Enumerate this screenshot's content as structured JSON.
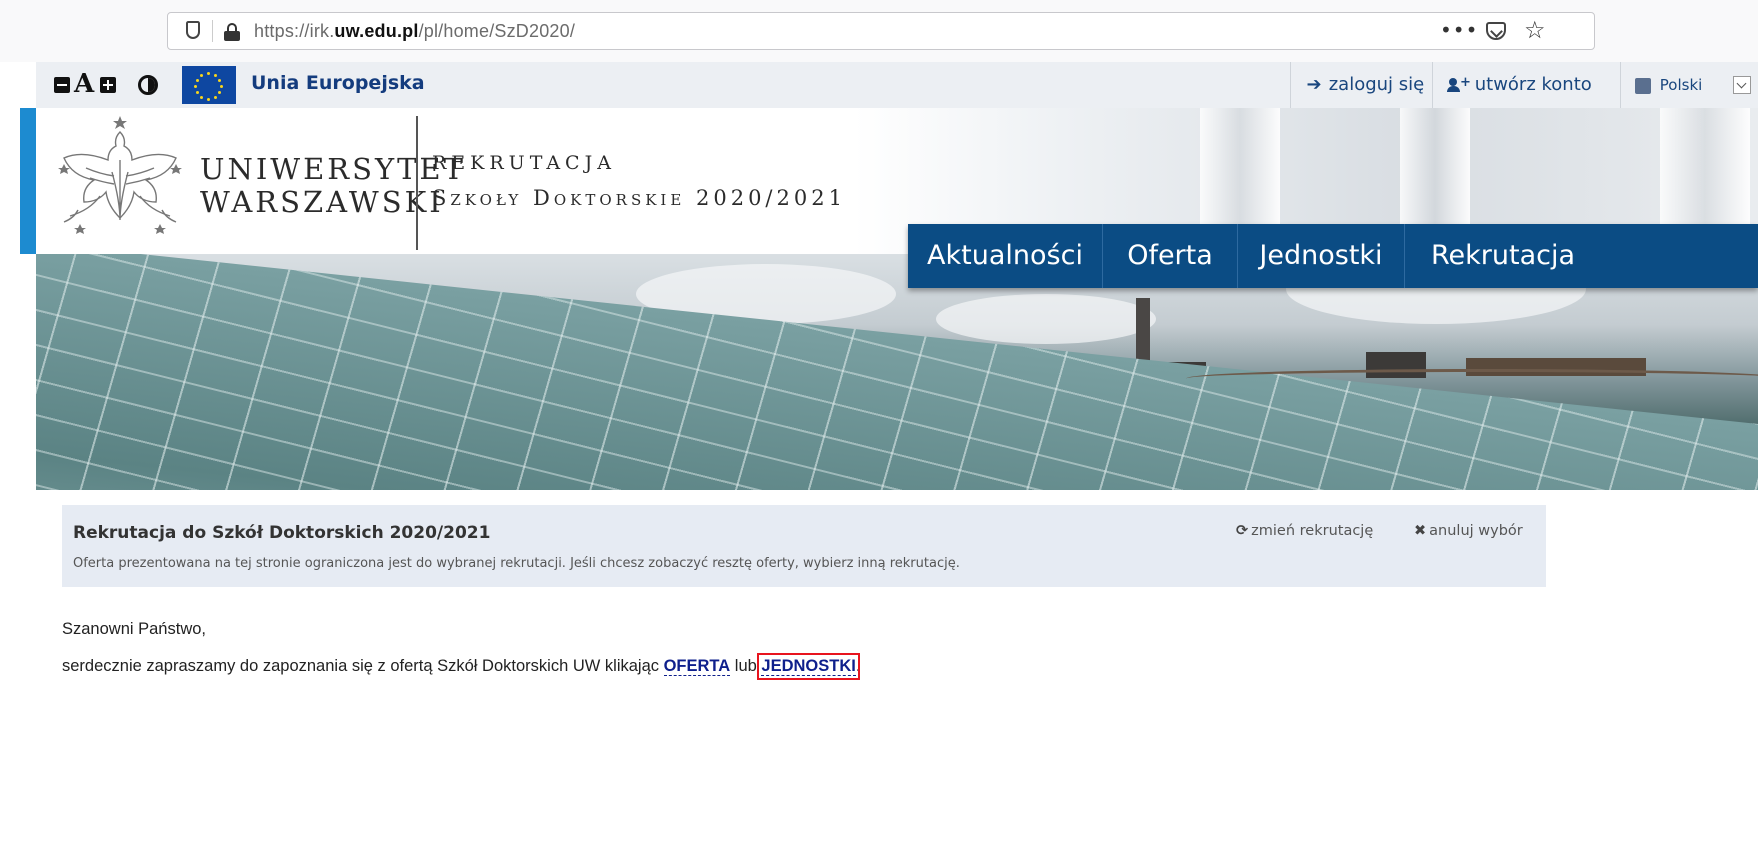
{
  "browser": {
    "url_prefix": "https://irk.",
    "url_domain": "uw.edu.pl",
    "url_path": "/pl/home/SzD2020/",
    "more_label": "•••"
  },
  "topbar": {
    "font_decrease_label": "A",
    "eu_label": "Unia Europejska",
    "login_label": "zaloguj się",
    "signup_label": "utwórz konto",
    "language_label": "Polski"
  },
  "header": {
    "university_line1": "UNIWERSYTET",
    "university_line2": "WARSZAWSKI",
    "recruitment_line1": "REKRUTACJA",
    "recruitment_line2": "Szkoły Doktorskie 2020/2021"
  },
  "nav": {
    "items": [
      {
        "label": "Aktualności"
      },
      {
        "label": "Oferta"
      },
      {
        "label": "Jednostki"
      },
      {
        "label": "Rekrutacja"
      }
    ]
  },
  "info": {
    "title": "Rekrutacja do Szkół Doktorskich 2020/2021",
    "subtitle": "Oferta prezentowana na tej stronie ograniczona jest do wybranej rekrutacji. Jeśli chcesz zobaczyć resztę oferty, wybierz inną rekrutację.",
    "change_label": "zmień rekrutację",
    "cancel_label": "anuluj wybór"
  },
  "content": {
    "greeting": "Szanowni Państwo,",
    "para_before": "serdecznie zapraszamy do zapoznania się z ofertą Szkół Doktorskich UW klikając ",
    "link_offer": "OFERTA",
    "para_middle": " lub ",
    "link_units": "JEDNOSTKI",
    "para_end": "."
  },
  "colors": {
    "nav_bg": "#0b4c84",
    "accent_blue": "#1d8bd0",
    "link": "#0e1f8c",
    "highlight": "#e8141e"
  }
}
